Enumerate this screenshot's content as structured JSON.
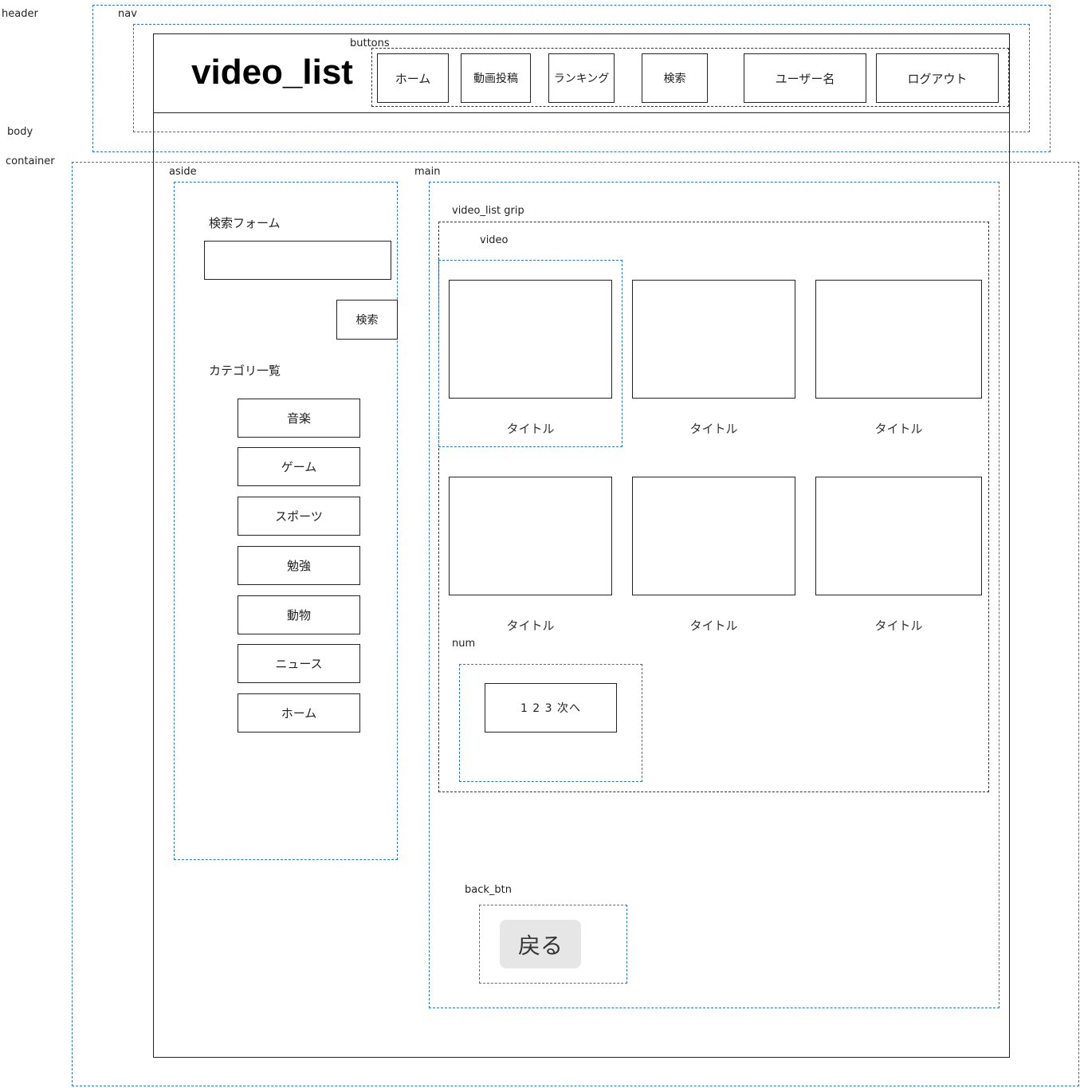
{
  "labels": {
    "header": "header",
    "nav": "nav",
    "body": "body",
    "container": "container",
    "buttons": "buttons",
    "aside": "aside",
    "main": "main",
    "video_list_grip": "video_list grip",
    "video": "video",
    "num": "num",
    "back_btn": "back_btn"
  },
  "logo": "video_list",
  "nav_buttons": [
    "ホーム",
    "動画投稿",
    "ランキング",
    "検索",
    "ユーザー名",
    "ログアウト"
  ],
  "aside": {
    "search_form_label": "検索フォーム",
    "search_input_value": "",
    "search_button": "検索",
    "category_label": "カテゴリ一覧",
    "categories": [
      "音楽",
      "ゲーム",
      "スポーツ",
      "勉強",
      "動物",
      "ニュース",
      "ホーム"
    ]
  },
  "videos": [
    {
      "title": "タイトル"
    },
    {
      "title": "タイトル"
    },
    {
      "title": "タイトル"
    },
    {
      "title": "タイトル"
    },
    {
      "title": "タイトル"
    },
    {
      "title": "タイトル"
    }
  ],
  "pagination": "1 2 3 次へ",
  "back_button": "戻る",
  "colors": {
    "region_border": "#2b78c0",
    "back_button_bg": "#e6e6e6"
  }
}
